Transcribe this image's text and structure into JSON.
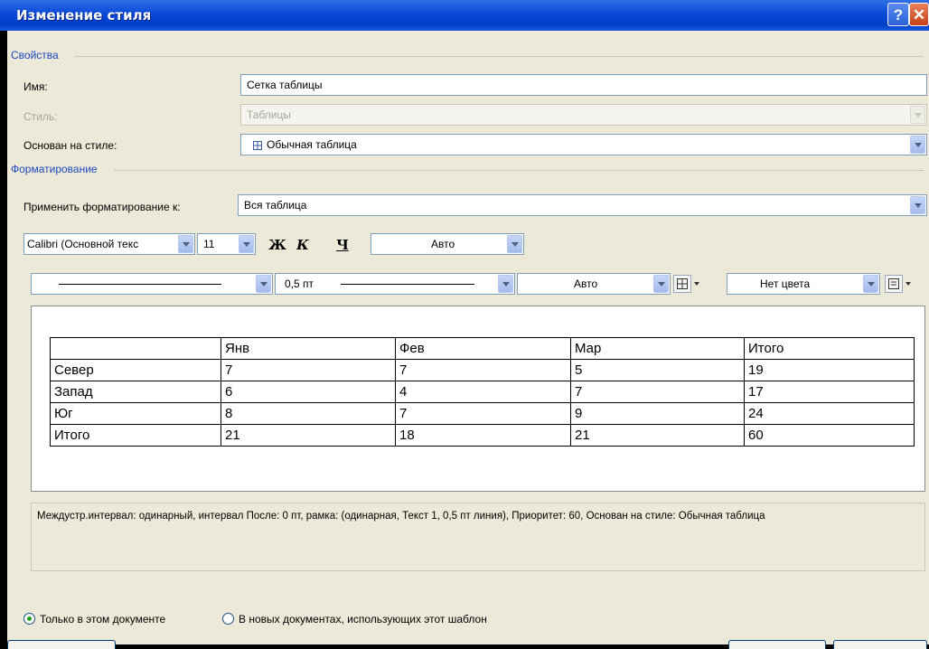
{
  "window": {
    "title": "Изменение стиля",
    "help_label": "?",
    "close_label": "✕"
  },
  "properties": {
    "group_label": "Свойства",
    "name_label": "Имя:",
    "name_value": "Сетка таблицы",
    "style_label": "Стиль:",
    "style_value": "Таблицы",
    "based_on_label": "Основан на стиле:",
    "based_on_value": "Обычная таблица",
    "based_on_icon": "table-grid-icon"
  },
  "formatting": {
    "group_label": "Форматирование",
    "apply_to_label": "Применить форматирование к:",
    "apply_to_value": "Вся таблица",
    "font_value": "Calibri (Основной текс",
    "size_value": "11",
    "bold_label": "Ж",
    "italic_label": "К",
    "underline_label": "Ч",
    "font_color_value": "Авто",
    "line_weight_value": "0,5 пт",
    "border_color_value": "Авто",
    "shading_value": "Нет цвета"
  },
  "preview": {
    "headers": [
      "",
      "Янв",
      "Фев",
      "Мар",
      "Итого"
    ],
    "rows": [
      [
        "Север",
        "7",
        "7",
        "5",
        "19"
      ],
      [
        "Запад",
        "6",
        "4",
        "7",
        "17"
      ],
      [
        "Юг",
        "8",
        "7",
        "9",
        "24"
      ],
      [
        "Итого",
        "21",
        "18",
        "21",
        "60"
      ]
    ]
  },
  "description": "Междустр.интервал:  одинарный, интервал После:  0 пт, рамка: (одинарная, Текст 1,  0,5 пт линия), Приоритет: 60, Основан на стиле: Обычная таблица",
  "scope": {
    "this_doc_label": "Только в этом документе",
    "this_doc_selected": true,
    "template_label": "В новых документах, использующих этот шаблон",
    "template_selected": false
  },
  "colors": {
    "titlebar": "#0a48d6",
    "dialog_bg": "#ece9d8",
    "group_text": "#1c47c0"
  }
}
